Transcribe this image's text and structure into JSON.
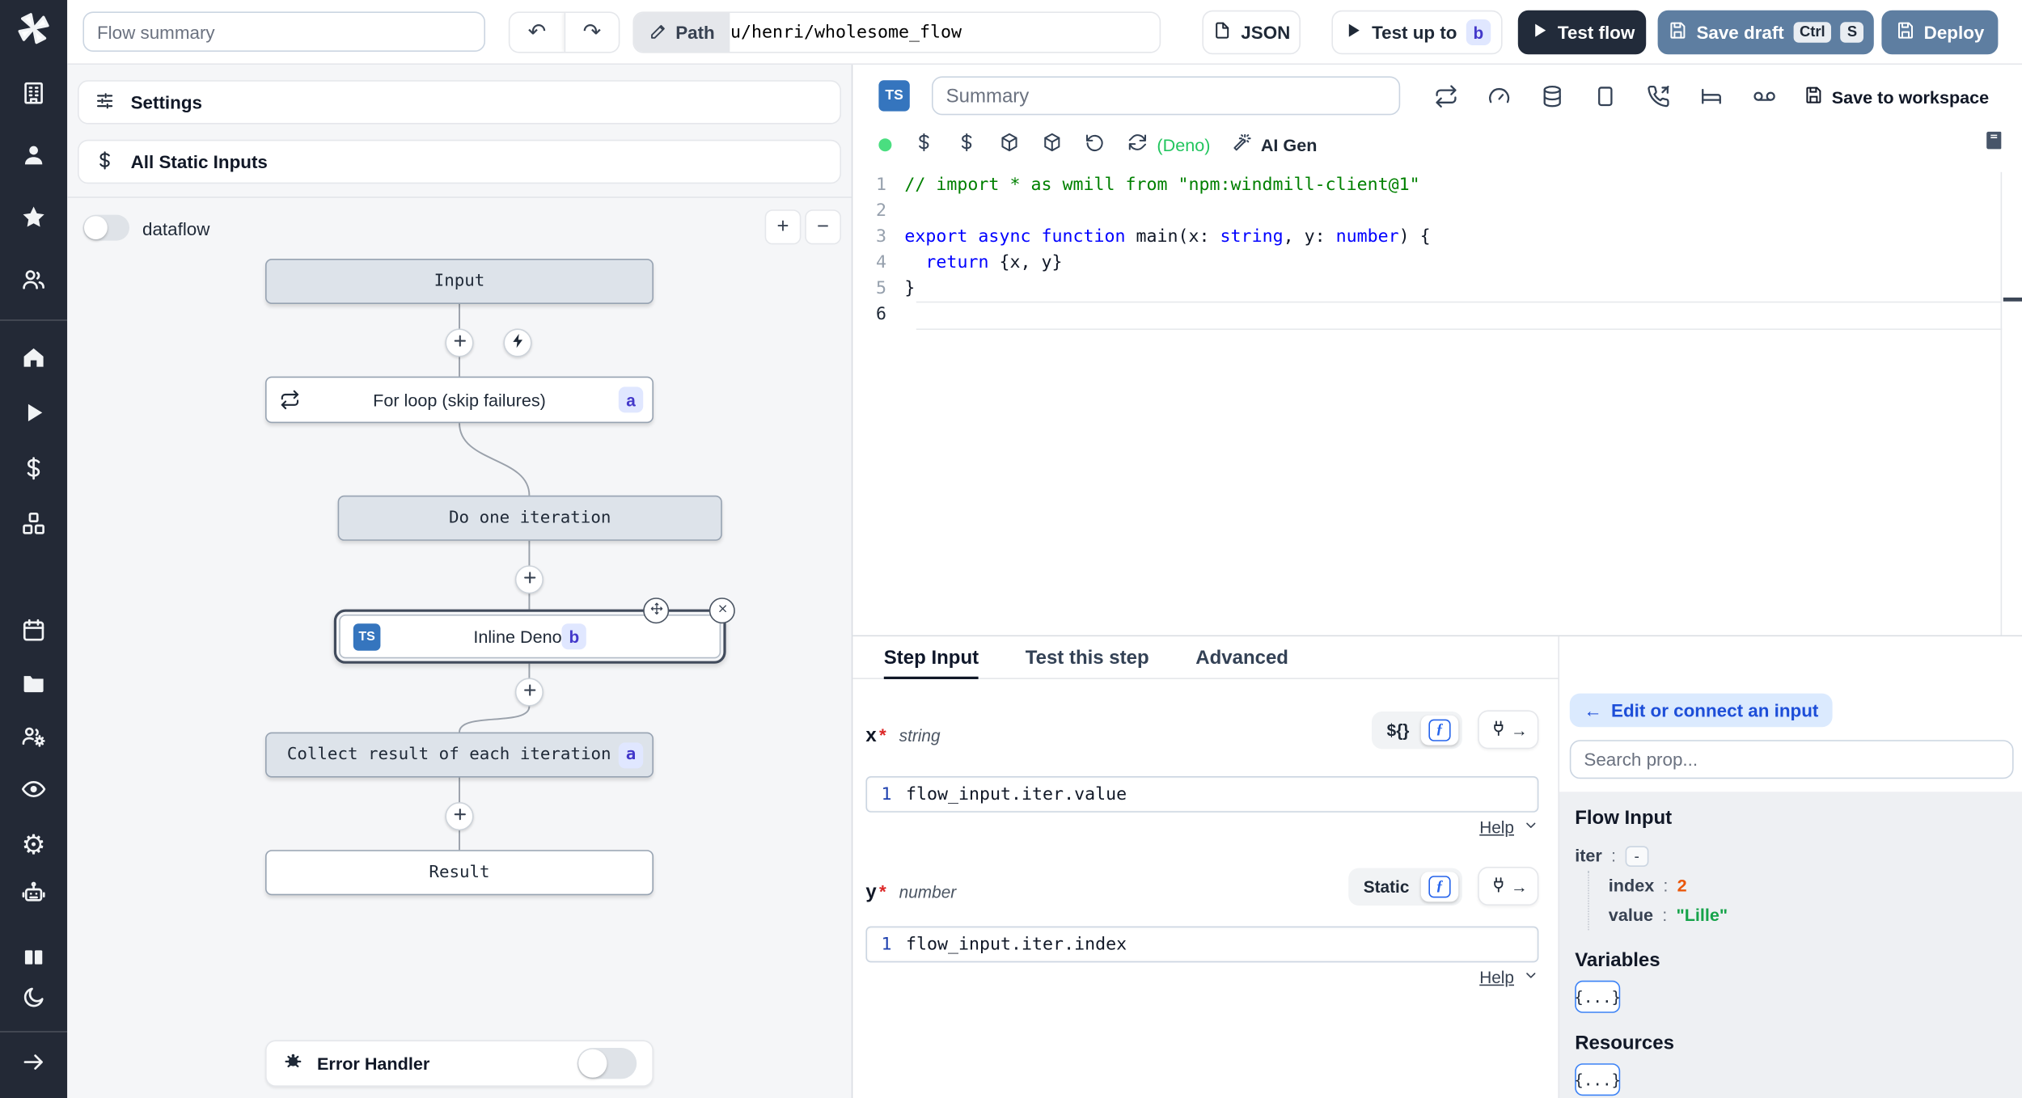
{
  "colors": {
    "sidebar_bg": "#232936",
    "ts_blue": "#3575be",
    "slate_button": "#5e7ea1",
    "dark_button": "#222b3a",
    "badge_bg": "#e0e7ff",
    "badge_text": "#4338ca",
    "deno_green": "#22c55e",
    "index_orange": "#ea580c",
    "string_green": "#16a34a",
    "link_blue": "#1d4ed8",
    "edit_connect_bg": "#dbeafe"
  },
  "sidebar": {
    "icons": [
      "windmill-logo",
      "building",
      "user",
      "star",
      "users",
      "home",
      "play",
      "dollar",
      "boxes",
      "calendar",
      "folder",
      "users-gear",
      "eye",
      "gear",
      "bot",
      "books",
      "moon",
      "arrow-right"
    ]
  },
  "topbar": {
    "summary_placeholder": "Flow summary",
    "path_label": "Path",
    "path_value": "u/henri/wholesome_flow",
    "json_button": "JSON",
    "test_up_to": "Test up to",
    "test_up_to_badge": "b",
    "test_flow": "Test flow",
    "save_draft": "Save draft",
    "kbd_ctrl": "Ctrl",
    "kbd_s": "S",
    "deploy": "Deploy"
  },
  "flow_panel": {
    "settings": "Settings",
    "all_static_inputs": "All Static Inputs",
    "dataflow_label": "dataflow",
    "zoom_in": "+",
    "zoom_out": "−",
    "error_handler": "Error Handler"
  },
  "graph": {
    "input_label": "Input",
    "for_loop_label": "For loop (skip failures)",
    "for_loop_badge": "a",
    "do_one_iteration_label": "Do one iteration",
    "inline_deno_label": "Inline Deno",
    "inline_deno_badge": "b",
    "inline_deno_lang": "TS",
    "collect_label": "Collect result of each iteration",
    "collect_badge": "a",
    "result_label": "Result"
  },
  "editor": {
    "lang_badge": "TS",
    "summary_placeholder": "Summary",
    "header_icons": [
      "repeat",
      "gauge",
      "database",
      "smartphone",
      "phone-incoming",
      "bed",
      "voicemail"
    ],
    "save_to_workspace": "Save to workspace",
    "toolbar_icons": [
      "status-dot",
      "dollar",
      "dollar",
      "package",
      "package",
      "rotate-ccw",
      "refresh-cw"
    ],
    "deno_label": "(Deno)",
    "ai_gen": "AI Gen",
    "lines": [
      {
        "n": "1",
        "tokens": [
          {
            "t": "// import * as wmill from \"npm:windmill-client@1\"",
            "c": "comment"
          }
        ]
      },
      {
        "n": "2",
        "tokens": []
      },
      {
        "n": "3",
        "tokens": [
          {
            "t": "export async function",
            "c": "kw"
          },
          {
            "t": " main(x: ",
            "c": "plain"
          },
          {
            "t": "string",
            "c": "kw"
          },
          {
            "t": ", y: ",
            "c": "plain"
          },
          {
            "t": "number",
            "c": "kw"
          },
          {
            "t": ") {",
            "c": "plain"
          }
        ]
      },
      {
        "n": "4",
        "tokens": [
          {
            "t": "  ",
            "c": "plain"
          },
          {
            "t": "return",
            "c": "kw"
          },
          {
            "t": " {x, y}",
            "c": "plain"
          }
        ]
      },
      {
        "n": "5",
        "tokens": [
          {
            "t": "}",
            "c": "plain"
          }
        ]
      },
      {
        "n": "6",
        "tokens": [],
        "active": true
      }
    ]
  },
  "tabs": [
    "Step Input",
    "Test this step",
    "Advanced"
  ],
  "step_panel": {
    "fields": [
      {
        "name": "x",
        "req": "*",
        "type": "string",
        "mode": "${}",
        "gutter": "1",
        "code": "flow_input.iter.value",
        "help": "Help"
      },
      {
        "name": "y",
        "req": "*",
        "type": "number",
        "mode": "Static",
        "gutter": "1",
        "code": "flow_input.iter.index",
        "help": "Help"
      }
    ],
    "plug_arrow": "→"
  },
  "props_panel": {
    "back_arrow": "←",
    "edit_connect": "Edit or connect an input",
    "search_placeholder": "Search prop...",
    "flow_input_title": "Flow Input",
    "colon": ":",
    "tree": {
      "root_key": "iter",
      "collapse": "-",
      "children": [
        {
          "key": "index",
          "value": "2"
        },
        {
          "key": "value",
          "value": "\"Lille\""
        }
      ]
    },
    "variables_title": "Variables",
    "variables_button": "{...}",
    "resources_title": "Resources",
    "resources_button": "{...}"
  }
}
